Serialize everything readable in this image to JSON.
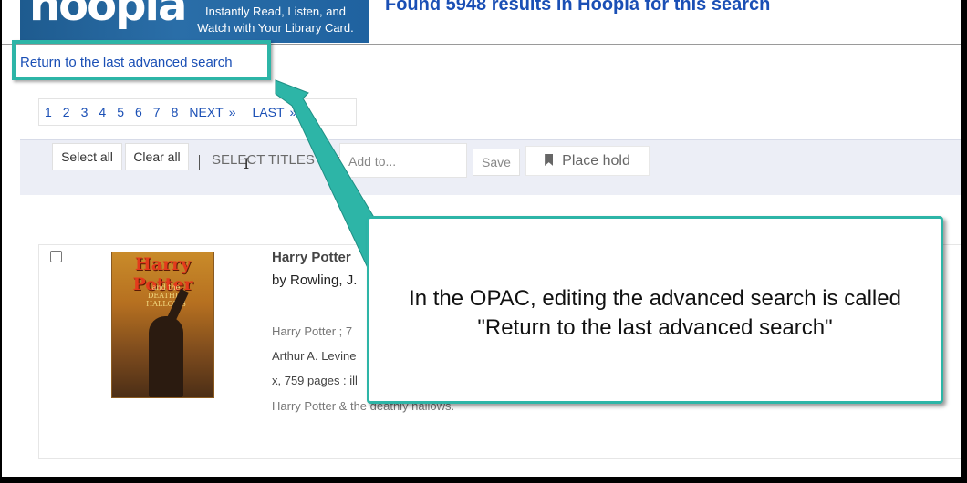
{
  "banner": {
    "logo_text": "hoopla",
    "tagline_line1": "Instantly Read, Listen, and",
    "tagline_line2": "Watch with Your Library Card."
  },
  "results_heading": "Found 5948 results in Hoopla for this search",
  "return_link": "Return to the last advanced search",
  "pagination": {
    "pages": [
      "1",
      "2",
      "3",
      "4",
      "5",
      "6",
      "7",
      "8"
    ],
    "next_label": "NEXT",
    "last_label": "LAST",
    "arrow_glyph": "»"
  },
  "toolbar": {
    "select_all": "Select all",
    "clear_all": "Clear all",
    "select_titles_label": "SELECT TITLES TO:",
    "add_to_placeholder": "Add to...",
    "save": "Save",
    "place_hold": "Place hold"
  },
  "record": {
    "cover_title": "Harry Potter",
    "cover_subtitle": "and the DEATHLY HALLOWS",
    "title": "Harry Potter",
    "author": "by Rowling, J.",
    "series": "Harry Potter ; 7",
    "publisher": "Arthur A. Levine",
    "physical": "x, 759 pages : ill",
    "alt_title": "Harry Potter & the deathly hallows."
  },
  "callout": {
    "line1": "In the OPAC, editing the advanced search is called",
    "line2": "\"Return to the last advanced search\""
  },
  "colors": {
    "annotation_teal": "#2db5a7",
    "link_blue": "#1a4fb5"
  }
}
